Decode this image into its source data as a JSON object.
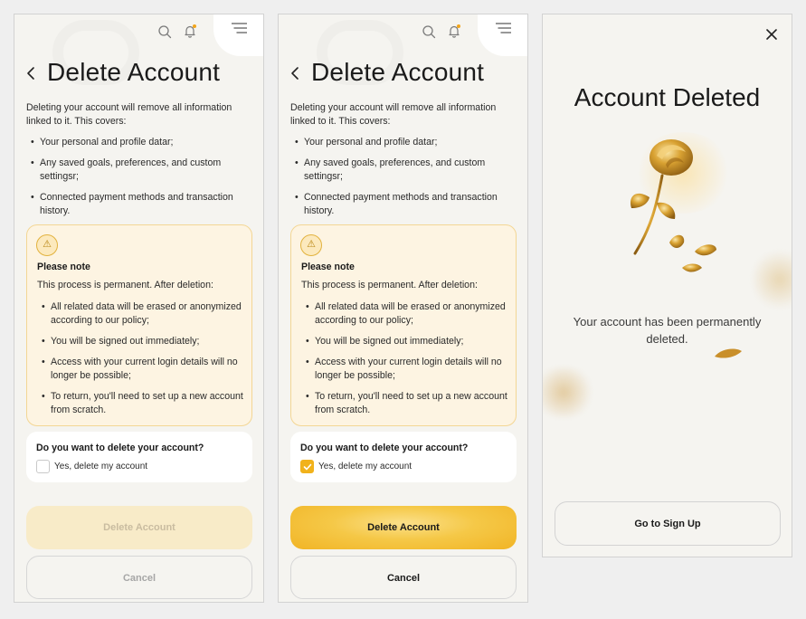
{
  "screens": [
    {
      "title": "Delete Account",
      "intro": "Deleting your account will remove all information linked to it. This covers:",
      "items": [
        "Your personal and profile datar;",
        "Any saved goals, preferences, and custom settingsr;",
        "Connected payment methods and transaction history."
      ],
      "note": {
        "title": "Please note",
        "subtitle": "This process is permanent. After deletion:",
        "items": [
          "All related data will be erased or anonymized according to our policy;",
          "You will be signed out immediately;",
          "Access with your current login details will no longer be possible;",
          "To return, you'll need to set up a new account from scratch."
        ]
      },
      "question": "Do you want to delete your account?",
      "checkbox_label": "Yes, delete my account",
      "checked": false,
      "delete_label": "Delete Account",
      "cancel_label": "Cancel"
    },
    {
      "title": "Delete Account",
      "intro": "Deleting your account will remove all information linked to it. This covers:",
      "items": [
        "Your personal and profile datar;",
        "Any saved goals, preferences, and custom settingsr;",
        "Connected payment methods and transaction history."
      ],
      "note": {
        "title": "Please note",
        "subtitle": "This process is permanent. After deletion:",
        "items": [
          "All related data will be erased or anonymized according to our policy;",
          "You will be signed out immediately;",
          "Access with your current login details will no longer be possible;",
          "To return, you'll need to set up a new account from scratch."
        ]
      },
      "question": "Do you want to delete your account?",
      "checkbox_label": "Yes, delete my account",
      "checked": true,
      "delete_label": "Delete Account",
      "cancel_label": "Cancel"
    }
  ],
  "confirmation": {
    "title": "Account Deleted",
    "message": "Your account has been permanently deleted.",
    "button_label": "Go to Sign Up"
  },
  "icons": {
    "search": "search-icon",
    "bell": "bell-icon",
    "menu": "menu-icon",
    "back": "chevron-left-icon",
    "warning": "warning-icon",
    "close": "close-icon",
    "rose": "golden-rose-icon"
  },
  "colors": {
    "accent": "#f1b21b",
    "background": "#f5f4f0",
    "note_background": "#fdf4e2",
    "note_border": "#f3d694",
    "disabled_button": "#f8ebc8"
  }
}
